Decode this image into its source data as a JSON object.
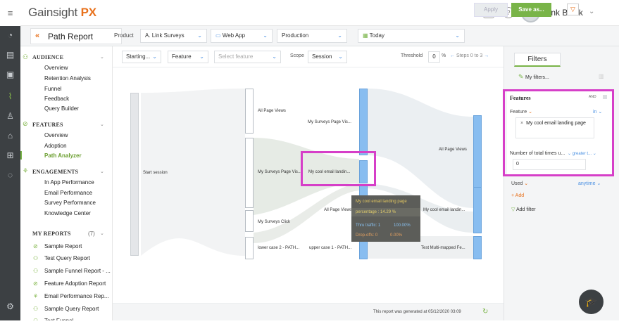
{
  "app": {
    "logo_main": "Gainsight",
    "logo_accent": "PX"
  },
  "user": {
    "initials": "LB",
    "name": "Link Black"
  },
  "header": {
    "back_label": "Path Report",
    "product_label": "Product",
    "product_value": "A. Link Surveys",
    "app_value": "Web App",
    "env_value": "Production",
    "date_value": "Today",
    "apply_label": "Apply",
    "saveas_label": "Save as..."
  },
  "sidebar": {
    "audience": {
      "title": "AUDIENCE",
      "items": [
        "Overview",
        "Retention Analysis",
        "Funnel",
        "Feedback",
        "Query Builder"
      ]
    },
    "features": {
      "title": "FEATURES",
      "items": [
        "Overview",
        "Adoption",
        "Path Analyzer"
      ]
    },
    "engagements": {
      "title": "ENGAGEMENTS",
      "items": [
        "In App Performance",
        "Email Performance",
        "Survey Performance",
        "Knowledge Center"
      ]
    },
    "myreports": {
      "title": "MY REPORTS",
      "count": "(7)",
      "items": [
        "Sample Report",
        "Test Query Report",
        "Sample Funnel Report - ...",
        "Feature Adoption Report",
        "Email Performance Rep...",
        "Sample Query Report",
        "Test Funnel"
      ]
    }
  },
  "toolbar": {
    "start_value": "Starting...",
    "type_value": "Feature",
    "select_placeholder": "Select feature",
    "scope_label": "Scope",
    "scope_value": "Session",
    "threshold_label": "Threshold",
    "threshold_value": "0",
    "percent": "%",
    "steps_text": "Steps 0 to 3"
  },
  "path": {
    "start": "Start session",
    "col1": [
      "All Page Views",
      "My Surveys Page Vis...",
      "My Surveys Click",
      "lower case 2 - PATH..."
    ],
    "col2": [
      "My Surveys Page Vis...",
      "My cool email landin...",
      "All Page Views",
      "upper case 1 - PATH..."
    ],
    "col3": [
      "All Page Views",
      "My cool email landin...",
      "Test Multi-mapped Fe..."
    ]
  },
  "tooltip": {
    "title": "My cool email landing page",
    "percentage": "percentage : 14.29 %",
    "thru_label": "Thru traffic: 1",
    "thru_pct": "100.00%",
    "drop_label": "Drop-offs: 0",
    "drop_pct": "0.00%"
  },
  "footer": {
    "generated": "This report was generated at 05/12/2020 03:09"
  },
  "filters": {
    "tab": "Filters",
    "my_filters": "My filters...",
    "features_title": "Features",
    "and_label": "AND",
    "feature_label": "Feature",
    "feature_op": "in",
    "chip_value": "My cool email landing page",
    "times_label": "Number of total times u...",
    "times_op": "greater t...",
    "times_value": "0",
    "used_label": "Used",
    "used_value": "anytime",
    "add_label": "+ Add",
    "add_filter": "Add filter"
  }
}
